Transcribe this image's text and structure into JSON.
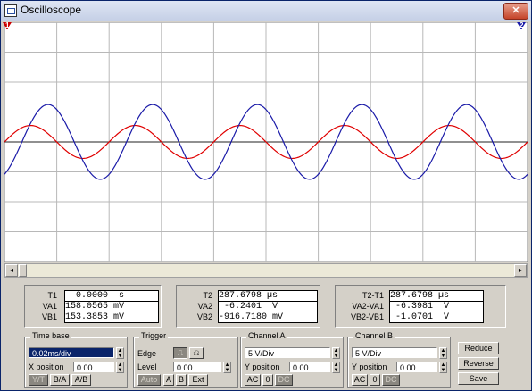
{
  "window": {
    "title": "Oscilloscope",
    "close_glyph": "✕"
  },
  "markers": {
    "t1": "1",
    "t2": "2"
  },
  "readouts": {
    "group1": [
      {
        "label": "T1",
        "value": "  0.0000  s"
      },
      {
        "label": "VA1",
        "value": "158.0565 mV"
      },
      {
        "label": "VB1",
        "value": "153.3853 mV"
      }
    ],
    "group2": [
      {
        "label": "T2",
        "value": "287.6798 µs"
      },
      {
        "label": "VA2",
        "value": " -6.2401  V"
      },
      {
        "label": "VB2",
        "value": "-916.7180 mV"
      }
    ],
    "group3": [
      {
        "label": "T2-T1",
        "value": "287.6798 µs"
      },
      {
        "label": "VA2-VA1",
        "value": " -6.3981  V"
      },
      {
        "label": "VB2-VB1",
        "value": " -1.0701  V"
      }
    ]
  },
  "timebase": {
    "title": "Time base",
    "value": "0.02ms/div",
    "xpos_label": "X position",
    "xpos_value": "0.00",
    "modes": [
      "Y/T",
      "B/A",
      "A/B"
    ]
  },
  "trigger": {
    "title": "Trigger",
    "edge_label": "Edge",
    "level_label": "Level",
    "level_value": "0.00",
    "buttons": [
      "Auto",
      "A",
      "B",
      "Ext"
    ]
  },
  "channel_a": {
    "title": "Channel A",
    "scale": "5 V/Div",
    "ypos_label": "Y position",
    "ypos_value": "0.00",
    "coupling": [
      "AC",
      "0",
      "DC"
    ]
  },
  "channel_b": {
    "title": "Channel B",
    "scale": "5 V/Div",
    "ypos_label": "Y position",
    "ypos_value": "0.00",
    "coupling": [
      "AC",
      "0",
      "DC"
    ]
  },
  "actions": [
    "Reduce",
    "Reverse",
    "Save"
  ],
  "colors": {
    "channel_a": "#e00000",
    "channel_b": "#1a1aa8",
    "grid": "#b8b8b8",
    "center": "#202020"
  },
  "chart_data": {
    "type": "line",
    "series": [
      {
        "amplitude_div": 0.55,
        "cycles_per_div": 0.5,
        "phase_deg": 0
      },
      {
        "amplitude_div": 1.25,
        "cycles_per_div": 0.5,
        "phase_deg": -60
      }
    ],
    "x_divisions": 10,
    "y_divisions": 8,
    "grid": true
  }
}
